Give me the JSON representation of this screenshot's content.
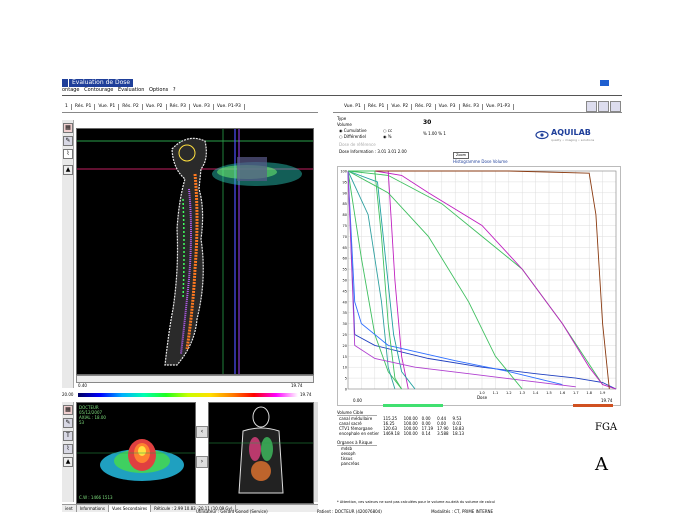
{
  "window": {
    "title": "Evaluation de Dose",
    "menu": [
      "ontage",
      "Contourage",
      "Evaluation",
      "Options",
      "?"
    ]
  },
  "left_tabs": [
    "1",
    "Rés. P1",
    "Vue. P1",
    "Rés. P2",
    "Vue. P2",
    "Rés. P3",
    "Vue. P3",
    "Vue. P1-P3"
  ],
  "right_tabs": [
    "Vue. P1",
    "Rés. P1",
    "Vue. P2",
    "Rés. P2",
    "Vue. P3",
    "Rés. P3",
    "Vue. P1-P3"
  ],
  "scale": {
    "min": "0.40",
    "max": "19.74",
    "left_readout": "20.00",
    "right_readout": "19.74"
  },
  "thumb_info": {
    "line1": "DOCTEUR",
    "line2": "05/12/2007",
    "line3": "AXIAL : 18.00",
    "line4": "53",
    "cw": "C.W : 1466 1513"
  },
  "statusbar": [
    "ient",
    "Informations",
    "Vues Secondaires",
    "Réticule : 2.99 10.83 -20.11 (10.09 Gy)"
  ],
  "dose_panel": {
    "type_label": "Type",
    "volume_label": "Volume",
    "cumulative_label": "Cumulative",
    "differential_label": "Différentiel",
    "unit_cc": "cc",
    "unit_percent": "%",
    "ref_dose_label": "Dose de référence",
    "ref_value": "30",
    "pct_readout": "% 1.00 % 1",
    "dose_info": "Dose Information : 3.01  3.01  2.00",
    "zoom_btn": "Zoom",
    "histogram_label": "Histogramme Dose Volume",
    "brand": "AQUILAB",
    "brand_tag": "quality • imaging • solutions"
  },
  "volumes": {
    "header": "Volume Cible",
    "col": "V1 %",
    "rows": [
      {
        "name": "canal médullaire",
        "v1": "115.25",
        "v2": "100.00",
        "a": "0.00",
        "b": "0.44",
        "c": "9.53"
      },
      {
        "name": "canal sacré",
        "v1": "16.25",
        "v2": "100.00",
        "a": "0.00",
        "b": "0.00",
        "c": "0.01"
      },
      {
        "name": "CTV1 fémorgane",
        "v1": "120.63",
        "v2": "100.00",
        "a": "17.19",
        "b": "17.90",
        "c": "18.83"
      },
      {
        "name": "encephale en entier",
        "v1": "1469.18",
        "v2": "100.00",
        "a": "0.14",
        "b": "3.588",
        "c": "18.13"
      }
    ],
    "organ_header": "Organes à Risque",
    "organs": [
      "mdsb",
      "oesoph",
      "tissus",
      "pancréas"
    ]
  },
  "glyphs": {
    "fga": "FGA",
    "alpha": "A"
  },
  "footnote": "* Attention, ces valeurs ne sont pas calculées pour le volume au-delà du volume de calcul",
  "footer": {
    "user": "Utilisateur : Gérard Gonod (Service)",
    "patient": "Patient : DOCTEUR (420076804)",
    "module": "Modalités : CT, PRIME INTERNE"
  },
  "chart_data": {
    "type": "line",
    "title": "",
    "xlabel": "Dose",
    "ylabel": "",
    "xlim": [
      0,
      2.0
    ],
    "ylim": [
      0,
      100
    ],
    "x_ticks": [
      "1.0",
      "1.1",
      "1.2",
      "1.3",
      "1.4",
      "1.5",
      "1.6",
      "1.7",
      "1.8",
      "1.9"
    ],
    "y_ticks": [
      "0",
      "5",
      "10",
      "15",
      "20",
      "25",
      "30",
      "35",
      "40",
      "45",
      "50",
      "55",
      "60",
      "65",
      "70",
      "75",
      "80",
      "85",
      "90",
      "95",
      "100"
    ],
    "series": [
      {
        "color": "#1f3fbf",
        "x": [
          0,
          0.05,
          0.2,
          0.6,
          1.0,
          1.4,
          1.7,
          1.9,
          2.0
        ],
        "y": [
          100,
          25,
          20,
          14,
          10,
          7,
          5,
          3,
          0
        ]
      },
      {
        "color": "#3fbf5f",
        "x": [
          0,
          0.3,
          0.7,
          1.0,
          1.3,
          1.6,
          1.9
        ],
        "y": [
          100,
          98,
          85,
          70,
          55,
          30,
          2
        ]
      },
      {
        "color": "#c020c0",
        "x": [
          0,
          0.2,
          0.4,
          0.6,
          1.0,
          1.3,
          1.6,
          1.8,
          1.9,
          2.0
        ],
        "y": [
          100,
          100,
          98,
          90,
          75,
          55,
          30,
          10,
          2,
          0
        ]
      },
      {
        "color": "#c020c0",
        "x": [
          0,
          0.3,
          0.32,
          0.35,
          0.4,
          0.45
        ],
        "y": [
          100,
          100,
          80,
          50,
          15,
          0
        ]
      },
      {
        "color": "#8a3a10",
        "x": [
          0,
          0.6,
          1.2,
          1.8,
          1.85,
          1.9,
          1.95
        ],
        "y": [
          100,
          100,
          100,
          99,
          80,
          30,
          0
        ]
      },
      {
        "color": "#3fbf5f",
        "x": [
          0,
          0.1,
          0.2,
          0.3,
          0.4
        ],
        "y": [
          100,
          60,
          25,
          8,
          0
        ]
      },
      {
        "color": "#2fa0a0",
        "x": [
          0,
          0.15,
          0.25,
          0.3,
          0.35
        ],
        "y": [
          100,
          80,
          40,
          10,
          0
        ]
      },
      {
        "color": "#2f6fff",
        "x": [
          0,
          0.05,
          0.1,
          0.3,
          0.8,
          1.2,
          1.6
        ],
        "y": [
          100,
          40,
          30,
          20,
          13,
          8,
          2
        ]
      },
      {
        "color": "#3fbf5f",
        "x": [
          0,
          0.2,
          0.25,
          0.3,
          0.35,
          0.4
        ],
        "y": [
          100,
          100,
          70,
          30,
          5,
          0
        ]
      },
      {
        "color": "#20a0a0",
        "x": [
          0,
          0.22,
          0.28,
          0.34,
          0.4,
          0.5
        ],
        "y": [
          100,
          95,
          60,
          25,
          8,
          0
        ]
      },
      {
        "color": "#b040d0",
        "x": [
          0,
          0.05,
          0.2,
          0.5,
          0.9,
          1.3,
          1.7
        ],
        "y": [
          100,
          20,
          14,
          10,
          7,
          4,
          1
        ]
      },
      {
        "color": "#3fbf5f",
        "x": [
          0,
          0.3,
          0.6,
          0.9,
          1.1,
          1.3
        ],
        "y": [
          100,
          90,
          70,
          40,
          15,
          0
        ]
      }
    ]
  }
}
